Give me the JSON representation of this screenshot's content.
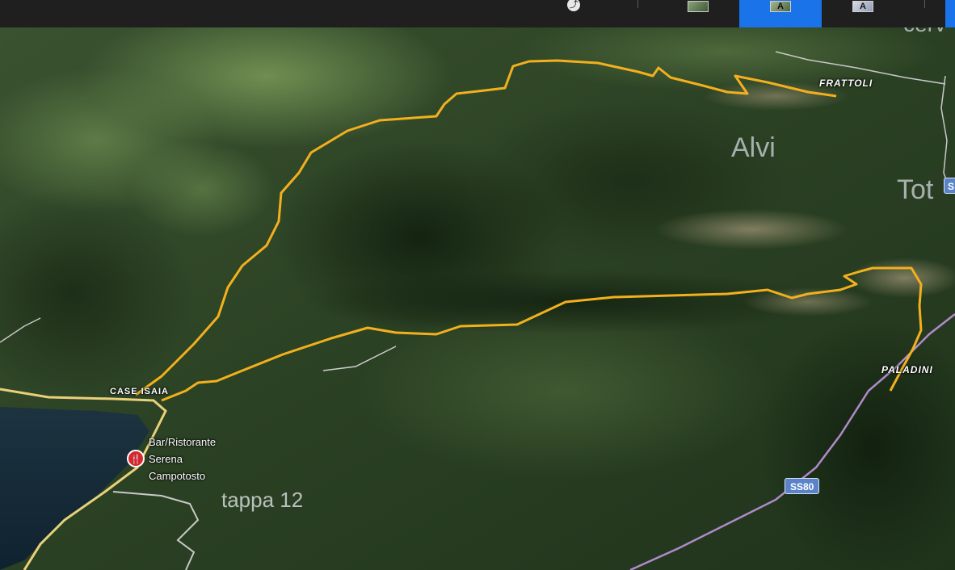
{
  "toolbar": {
    "buttons": [
      {
        "name": "share-icon",
        "glyph": "⤴"
      },
      {
        "name": "map-style-road",
        "glyph": ""
      },
      {
        "name": "map-style-aerial-labels",
        "glyph": "A"
      },
      {
        "name": "map-style-streetside",
        "glyph": "A"
      }
    ]
  },
  "map": {
    "places": {
      "frattoli": "FRATTOLI",
      "paladini": "PALADINI",
      "case_isaia": "CASE ISAIA",
      "alvi": "Alvi",
      "tot": "Tot",
      "cerv": "cerv"
    },
    "poi": {
      "name_line1": "Bar/Ristorante",
      "name_line2": "Serena",
      "name_line3": "Campotosto",
      "icon": "restaurant-icon"
    },
    "area_label": "tappa 12",
    "road_shield": "SS80",
    "road_shield_partial": "S",
    "colors": {
      "track": "#f2b01e",
      "road_shield": "#5b84c8",
      "selected_button": "#1a73e8",
      "poi": "#d9262c"
    }
  }
}
